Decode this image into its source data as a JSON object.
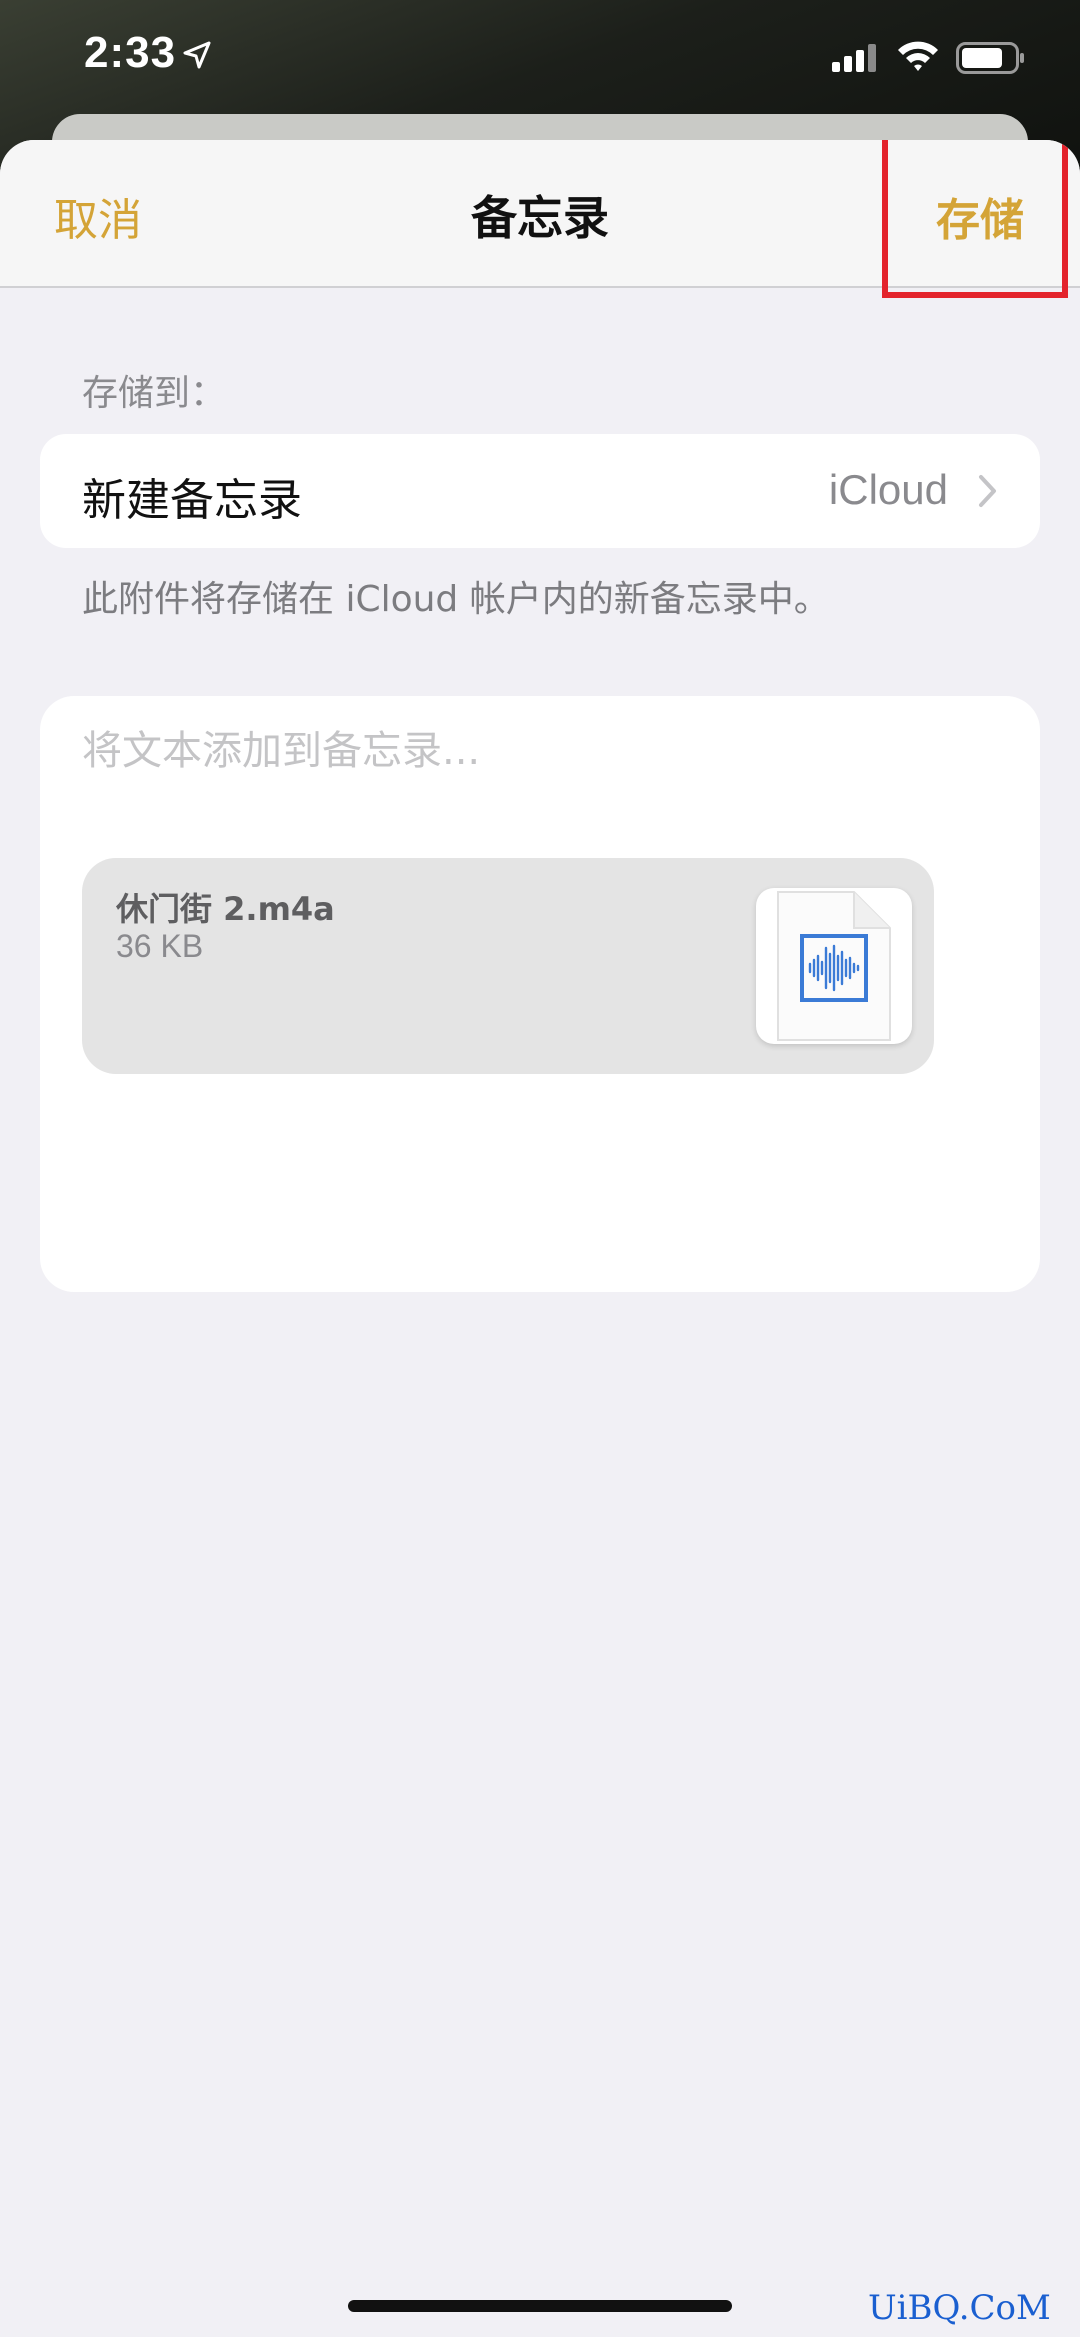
{
  "status_bar": {
    "time": "2:33",
    "icons": [
      "location-arrow-icon",
      "cellular-signal-icon",
      "wifi-icon",
      "battery-icon"
    ]
  },
  "nav": {
    "cancel_label": "取消",
    "title": "备忘录",
    "save_label": "存储"
  },
  "destination": {
    "section_label": "存储到：",
    "row_label": "新建备忘录",
    "row_value": "iCloud",
    "footnote": "此附件将存储在 iCloud 帐户内的新备忘录中。"
  },
  "note": {
    "placeholder": "将文本添加到备忘录...",
    "attachment": {
      "name": "休门街 2.m4a",
      "size": "36 KB",
      "icon": "audio-file-icon"
    }
  },
  "watermark": "UiBQ.CoM",
  "colors": {
    "accent": "#d4a437",
    "highlight": "#e3232c",
    "background": "#f1f0f5",
    "audio_icon": "#3b7bd6"
  }
}
